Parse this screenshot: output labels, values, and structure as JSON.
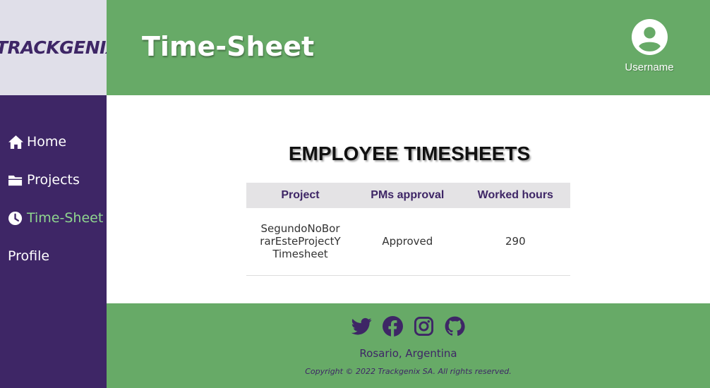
{
  "brand": {
    "logo_text": "TRACKGENIX"
  },
  "header": {
    "title": "Time-Sheet",
    "username": "Username"
  },
  "sidebar": {
    "items": [
      {
        "label": "Home",
        "icon": "home-icon",
        "active": false
      },
      {
        "label": "Projects",
        "icon": "folder-icon",
        "active": false
      },
      {
        "label": "Time-Sheet",
        "icon": "clock-icon",
        "active": true
      },
      {
        "label": "Profile",
        "icon": "",
        "active": false
      }
    ]
  },
  "main": {
    "heading": "EMPLOYEE TIMESHEETS",
    "table": {
      "columns": [
        "Project",
        "PMs approval",
        "Worked hours"
      ],
      "rows": [
        {
          "project": "SegundoNoBorrarEsteProjectYTimesheet",
          "approval": "Approved",
          "hours": "290"
        }
      ]
    }
  },
  "footer": {
    "social": [
      "twitter-icon",
      "facebook-icon",
      "instagram-icon",
      "github-icon"
    ],
    "location": "Rosario, Argentina",
    "copyright": "Copyright © 2022 Trackgenix SA. All rights reserved."
  },
  "colors": {
    "primary": "#3e2666",
    "accent_green": "#67aa67",
    "active_nav": "#8fd68f",
    "logo_bg": "#e0dfe9"
  }
}
